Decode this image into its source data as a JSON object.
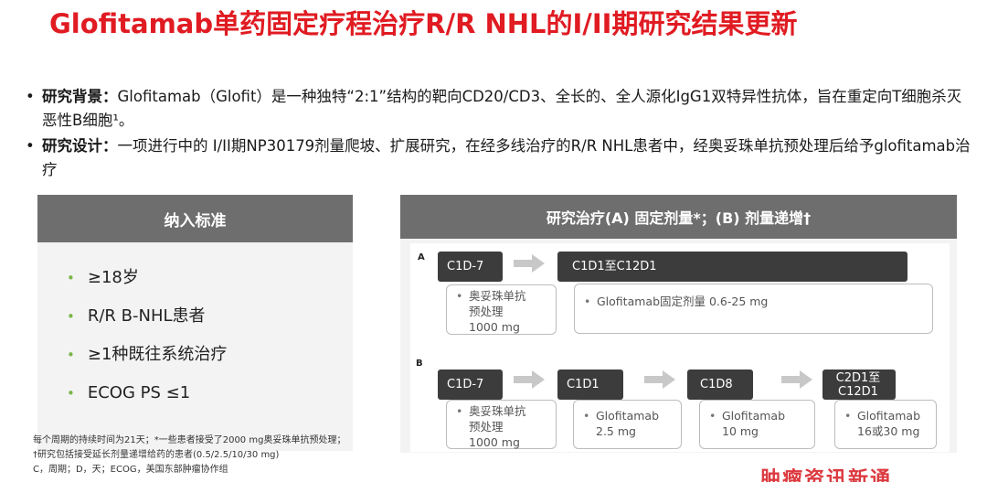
{
  "title": "Glofitamab单药固定疗程治疗R/R NHL的I/II期研究结果更新",
  "bullets": [
    {
      "label": "研究背景：",
      "text": "Glofitamab（Glofit）是一种独特“2:1”结构的靶向CD20/CD3、全长的、全人源化IgG1双特异性抗体，旨在重定向T细胞杀灭恶性B细胞¹。"
    },
    {
      "label": "研究设计：",
      "text": "一项进行中的 I/II期NP30179剂量爬坡、扩展研究，在经多线治疗的R/R NHL患者中，经奥妥珠单抗预处理后给予glofitamab治疗"
    }
  ],
  "inclusion": {
    "header": "纳入标准",
    "items": [
      "≥18岁",
      "R/R B-NHL患者",
      "≥1种既往系统治疗",
      "ECOG PS ≤1"
    ]
  },
  "treatment": {
    "header": "研究治疗(A) 固定剂量*；(B) 剂量递增†",
    "a": {
      "label": "A",
      "steps": [
        {
          "cycle": "C1D-7",
          "lines": [
            "奥妥珠单抗",
            "预处理",
            "1000 mg"
          ]
        },
        {
          "cycle": "C1D1至C12D1",
          "lines": [
            "Glofitamab固定剂量 0.6-25 mg"
          ]
        }
      ]
    },
    "b": {
      "label": "B",
      "steps": [
        {
          "cycle": "C1D-7",
          "lines": [
            "奥妥珠单抗",
            "预处理",
            "1000 mg"
          ]
        },
        {
          "cycle": "C1D1",
          "lines": [
            "Glofitamab",
            "2.5 mg"
          ]
        },
        {
          "cycle": "C1D8",
          "lines": [
            "Glofitamab",
            "10 mg"
          ]
        },
        {
          "cycle": "C2D1至C12D1",
          "lines": [
            "Glofitamab",
            "16或30 mg"
          ]
        }
      ]
    }
  },
  "footnotes": [
    "每个周期的持续时间为21天；*一些患者接受了2000 mg奥妥珠单抗预处理；",
    "†研究包括接受延长剂量递增给药的患者(0.5/2.5/10/30 mg)",
    "C，周期；D，天；ECOG，美国东部肿瘤协作组"
  ],
  "watermark": "肿瘤资讯新通",
  "colors": {
    "title": "#e01b22",
    "header_bg": "#6e6e6e",
    "dark_box": "#3c3c3c",
    "bullet_dot": "#7ab648"
  }
}
